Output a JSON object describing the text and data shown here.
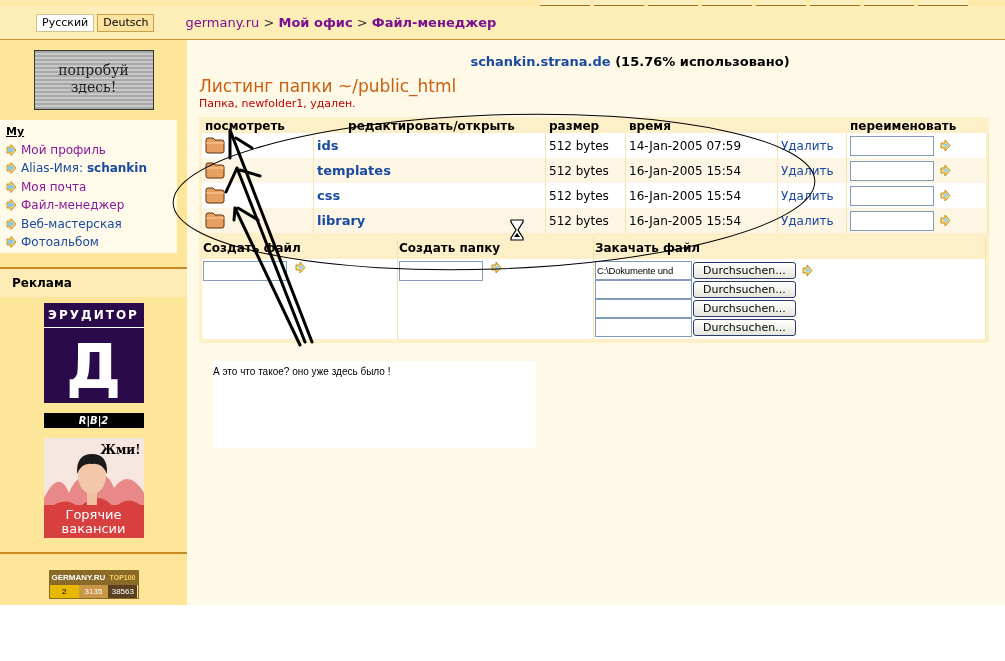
{
  "language_buttons": [
    {
      "label": "Русский",
      "selected": false
    },
    {
      "label": "Deutsch",
      "selected": true
    }
  ],
  "breadcrumb": {
    "items": [
      {
        "label": "germany.ru",
        "bold": false
      },
      {
        "label": "Мой офис",
        "bold": true
      },
      {
        "label": "Файл-менеджер",
        "bold": true
      }
    ],
    "separator": ">"
  },
  "sidebar": {
    "promo": "попробуй здесь!",
    "menu_title": "My",
    "items": [
      {
        "label": "Мой профиль",
        "visited": true
      },
      {
        "label": "Alias-Имя: **schankin**",
        "visited": false
      },
      {
        "label": "Моя почта",
        "visited": true
      },
      {
        "label": "Файл-менеджер",
        "visited": true
      },
      {
        "label": "Веб-мастерская",
        "visited": false
      },
      {
        "label": "Фотоальбом",
        "visited": false
      }
    ],
    "ads_title": "Реклама",
    "erudit_banner": {
      "title": "ЭРУДИТОР",
      "letter": "Д"
    },
    "rb2_banner": "R|B|2",
    "jobs_banner": {
      "cta": "Жми!",
      "caption": "Горячие вакансии",
      "kind": "picture"
    },
    "counter": {
      "brand": "GERMANY.RU",
      "tag": "TOP100",
      "values": [
        "2",
        "3135",
        "38563"
      ]
    }
  },
  "quota": {
    "site": "schankin.strana.de",
    "usage": "(15.76% использовано)"
  },
  "heading": "Листинг папки ~/public_html",
  "message": "Папка, newfolder1, удален.",
  "table": {
    "columns": {
      "view": "посмотреть",
      "edit": "редактировать/открыть",
      "size": "размер",
      "time": "время",
      "rename": "переименовать"
    },
    "rows": [
      {
        "name": "ids",
        "size": "512 bytes",
        "time": "14-Jan-2005 07:59",
        "action": "Удалить"
      },
      {
        "name": "templates",
        "size": "512 bytes",
        "time": "16-Jan-2005 15:54",
        "action": "Удалить"
      },
      {
        "name": "css",
        "size": "512 bytes",
        "time": "16-Jan-2005 15:54",
        "action": "Удалить"
      },
      {
        "name": "library",
        "size": "512 bytes",
        "time": "16-Jan-2005 15:54",
        "action": "Удалить"
      }
    ]
  },
  "forms": {
    "create_file": "Создать файл",
    "create_folder": "Создать папку",
    "upload": "Закачать файл",
    "uploads": [
      {
        "value": "C:\\Dokumente und",
        "browse_button": "Durchsuchen..."
      },
      {
        "browse_button": "Durchsuchen..."
      },
      {
        "browse_button": "Durchsuchen..."
      },
      {
        "browse_button": "Durchsuchen..."
      }
    ]
  },
  "comment": "А это что такое?  оно уже здесь было !"
}
